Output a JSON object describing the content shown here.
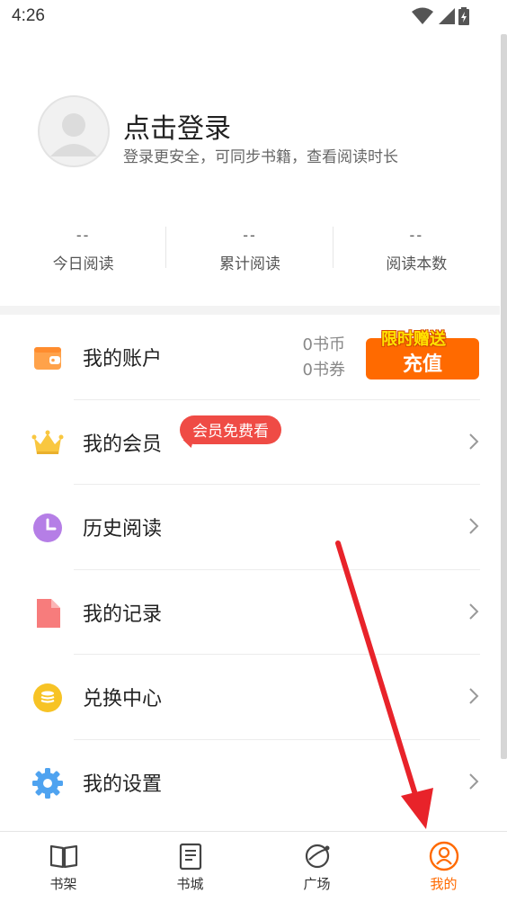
{
  "status_bar": {
    "time": "4:26"
  },
  "profile": {
    "login_title": "点击登录",
    "login_subtitle": "登录更安全，可同步书籍，查看阅读时长"
  },
  "stats": [
    {
      "value": "--",
      "label": "今日阅读"
    },
    {
      "value": "--",
      "label": "累计阅读"
    },
    {
      "value": "--",
      "label": "阅读本数"
    }
  ],
  "menu": {
    "account": {
      "label": "我的账户",
      "coins": "0书币",
      "vouchers": "0书券",
      "promo": "限时赠送",
      "recharge": "充值"
    },
    "vip": {
      "label": "我的会员",
      "badge": "会员免费看"
    },
    "history": {
      "label": "历史阅读"
    },
    "records": {
      "label": "我的记录"
    },
    "exchange": {
      "label": "兑换中心"
    },
    "settings": {
      "label": "我的设置"
    }
  },
  "tabbar": {
    "tabs": [
      {
        "label": "书架",
        "icon": "book-open-icon"
      },
      {
        "label": "书城",
        "icon": "book-store-icon"
      },
      {
        "label": "广场",
        "icon": "planet-icon"
      },
      {
        "label": "我的",
        "icon": "user-icon",
        "active": true
      }
    ]
  },
  "colors": {
    "accent": "#ff6a00",
    "vip_badge": "#ef4b45",
    "annotation_arrow": "#e8232a"
  }
}
